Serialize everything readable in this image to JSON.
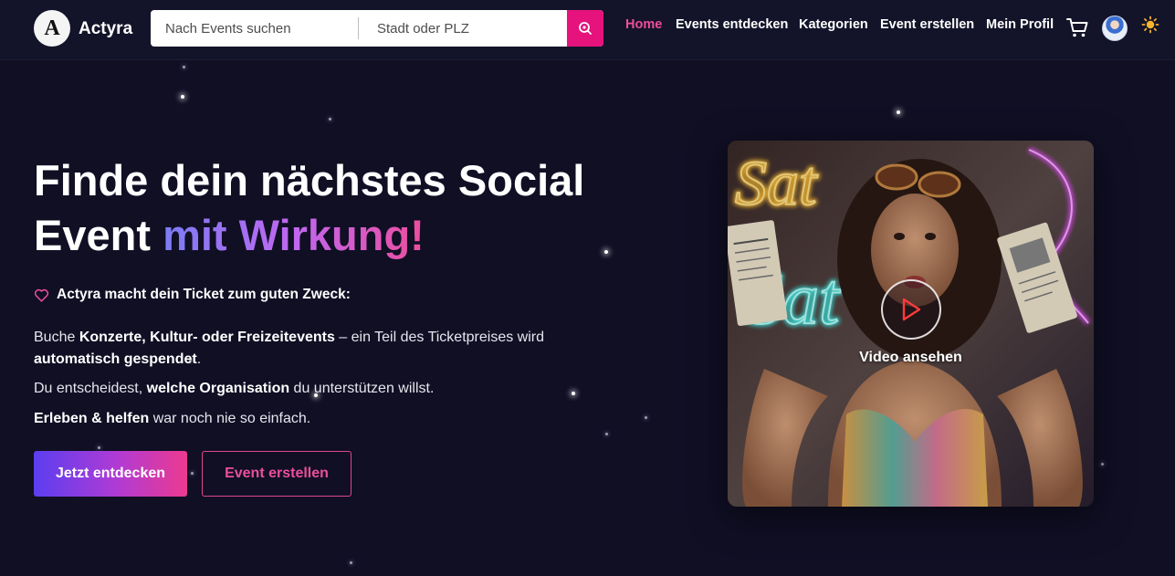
{
  "header": {
    "logo_letter": "A",
    "brand": "Actyra",
    "search_placeholder": "Nach Events suchen",
    "city_placeholder": "Stadt oder PLZ",
    "nav": [
      {
        "label": "Home",
        "active": true
      },
      {
        "label": "Events entdecken",
        "active": false
      },
      {
        "label": "Kategorien",
        "active": false
      },
      {
        "label": "Event erstellen",
        "active": false
      },
      {
        "label": "Mein Profil",
        "active": false
      }
    ],
    "icons": [
      "search-icon",
      "cart-icon",
      "avatar",
      "sun-icon"
    ]
  },
  "hero": {
    "title_part1": "Finde dein nächstes Social",
    "title_part2": "Event",
    "title_highlight": "mit Wirkung!",
    "tagline": "Actyra macht dein Ticket zum guten Zweck:",
    "p1_a": "Buche ",
    "p1_b": "Konzerte, Kultur- oder Freizeitevents",
    "p1_c": " – ein Teil des Ticketpreises wird ",
    "p1_d": "automatisch gespendet",
    "p1_e": ".",
    "p2_a": "Du entscheidest, ",
    "p2_b": "welche Organisation",
    "p2_c": " du unterstützen willst.",
    "p3_a": "Erleben & helfen",
    "p3_b": " war noch nie so einfach.",
    "primary_button": "Jetzt entdecken",
    "secondary_button": "Event erstellen"
  },
  "video": {
    "label": "Video ansehen",
    "neon_text": "Saturday"
  },
  "colors": {
    "background": "#100f24",
    "header": "#13132a",
    "accent_pink": "#ec4e9c",
    "search_button": "#e6137d",
    "gradient_start": "#5b3ef0",
    "gradient_end": "#ec3a8f"
  }
}
